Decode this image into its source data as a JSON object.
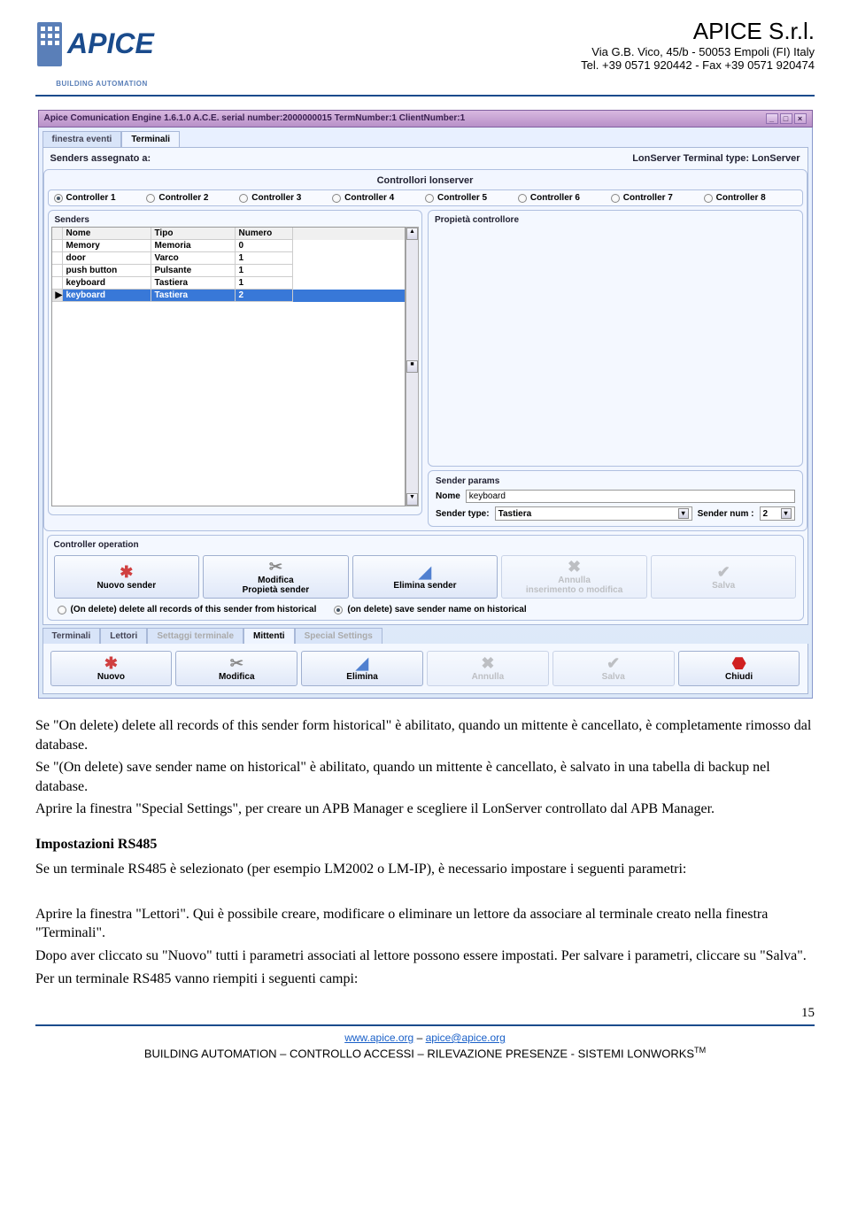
{
  "header": {
    "logo_sub": "BUILDING AUTOMATION",
    "company_name": "APICE S.r.l.",
    "address": "Via G.B. Vico, 45/b - 50053 Empoli (FI) Italy",
    "tel": "Tel. +39 0571 920442 - Fax +39 0571 920474"
  },
  "screenshot": {
    "titlebar": "Apice Comunication Engine 1.6.1.0 A.C.E. serial number:2000000015 TermNumber:1 ClientNumber:1",
    "tabs": {
      "t1": "finestra eventi",
      "t2": "Terminali"
    },
    "senders_assigned_label": "Senders assegnato a:",
    "lonserver_label": "LonServer Terminal type: LonServer",
    "controllers_title": "Controllori lonserver",
    "controllers": [
      "Controller 1",
      "Controller 2",
      "Controller 3",
      "Controller 4",
      "Controller 5",
      "Controller 6",
      "Controller 7",
      "Controller 8"
    ],
    "senders_group": "Senders",
    "props_group": "Propietà controllore",
    "table": {
      "headers": [
        "Nome",
        "Tipo",
        "Numero"
      ],
      "rows": [
        [
          "Memory",
          "Memoria",
          "0"
        ],
        [
          "door",
          "Varco",
          "1"
        ],
        [
          "push button",
          "Pulsante",
          "1"
        ],
        [
          "keyboard",
          "Tastiera",
          "1"
        ],
        [
          "keyboard",
          "Tastiera",
          "2"
        ]
      ]
    },
    "sender_params_title": "Sender params",
    "sp_nome_label": "Nome",
    "sp_nome_value": "keyboard",
    "sp_type_label": "Sender type:",
    "sp_type_value": "Tastiera",
    "sp_num_label": "Sender num :",
    "sp_num_value": "2",
    "controller_op_title": "Controller operation",
    "buttons1": {
      "b1": "Nuovo sender",
      "b2a": "Modifica",
      "b2b": "Propietà sender",
      "b3": "Elimina sender",
      "b4a": "Annulla",
      "b4b": "inserimento o modifica",
      "b5": "Salva"
    },
    "opt1": "(On delete) delete all records of this sender from historical",
    "opt2": "(on delete) save sender name on historical",
    "tabs2": [
      "Terminali",
      "Lettori",
      "Settaggi terminale",
      "Mittenti",
      "Special Settings"
    ],
    "buttons2": {
      "b1": "Nuovo",
      "b2": "Modifica",
      "b3": "Elimina",
      "b4": "Annulla",
      "b5": "Salva",
      "b6": "Chiudi"
    }
  },
  "body": {
    "p1a": "Se \"On delete) delete all records of this sender form historical\" è abilitato, quando un mittente è cancellato, è completamente rimosso dal database.",
    "p2": "Se \"(On delete) save sender name on historical\" è abilitato, quando un mittente è cancellato, è salvato in una tabella di backup nel database.",
    "p3": "Aprire la finestra \"Special Settings\", per creare un APB Manager e scegliere il LonServer controllato dal APB Manager.",
    "h4": "Impostazioni RS485",
    "p4": "Se un terminale RS485 è selezionato (per esempio LM2002 o LM-IP), è necessario impostare i seguenti parametri:",
    "p5": "Aprire la finestra \"Lettori\". Qui è possibile creare, modificare o eliminare un lettore da associare al terminale creato nella finestra \"Terminali\".",
    "p6": "Dopo aver cliccato su \"Nuovo\" tutti i parametri associati al lettore possono essere impostati. Per salvare i parametri, cliccare su \"Salva\".",
    "p7": "Per un terminale RS485 vanno riempiti i seguenti campi:"
  },
  "footer": {
    "page": "15",
    "link1": "www.apice.org",
    "sep": " – ",
    "link2": "apice@apice.org",
    "line2": "BUILDING AUTOMATION – CONTROLLO ACCESSI – RILEVAZIONE PRESENZE - SISTEMI LONWORKS",
    "tm": "TM"
  }
}
